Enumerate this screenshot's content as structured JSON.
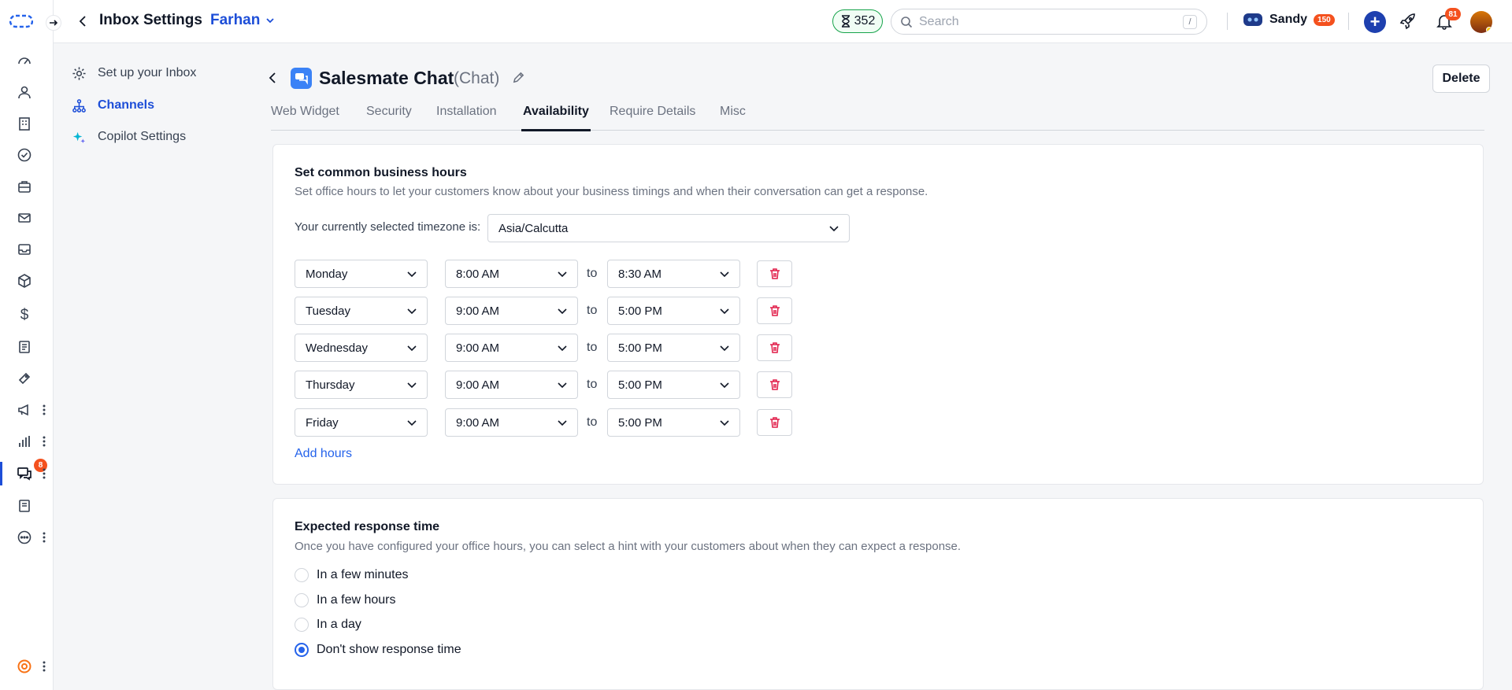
{
  "header": {
    "title": "Inbox Settings",
    "workspace": "Farhan",
    "timer_count": "352",
    "search_placeholder": "Search",
    "search_shortcut": "/",
    "user_name": "Sandy",
    "user_badge": "150",
    "notifications_count": "81"
  },
  "rail": {
    "chat_badge": "8"
  },
  "settings_nav": {
    "items": [
      {
        "label": "Set up your Inbox"
      },
      {
        "label": "Channels"
      },
      {
        "label": "Copilot Settings"
      }
    ]
  },
  "channel": {
    "name": "Salesmate Chat",
    "type": "(Chat)",
    "delete_label": "Delete"
  },
  "tabs": [
    {
      "label": "Web Widget"
    },
    {
      "label": "Security"
    },
    {
      "label": "Installation"
    },
    {
      "label": "Availability"
    },
    {
      "label": "Require Details"
    },
    {
      "label": "Misc"
    }
  ],
  "business_hours": {
    "title": "Set common business hours",
    "description": "Set office hours to let your customers know about your business timings and when their conversation can get a response.",
    "timezone_label": "Your currently selected timezone is:",
    "timezone": "Asia/Calcutta",
    "to_label": "to",
    "rows": [
      {
        "day": "Monday",
        "from": "8:00 AM",
        "to": "8:30 AM"
      },
      {
        "day": "Tuesday",
        "from": "9:00 AM",
        "to": "5:00 PM"
      },
      {
        "day": "Wednesday",
        "from": "9:00 AM",
        "to": "5:00 PM"
      },
      {
        "day": "Thursday",
        "from": "9:00 AM",
        "to": "5:00 PM"
      },
      {
        "day": "Friday",
        "from": "9:00 AM",
        "to": "5:00 PM"
      }
    ],
    "add_hours_label": "Add hours"
  },
  "response_time": {
    "title": "Expected response time",
    "description": "Once you have configured your office hours, you can select a hint with your customers about when they can expect a response.",
    "options": [
      {
        "label": "In a few minutes",
        "selected": false
      },
      {
        "label": "In a few hours",
        "selected": false
      },
      {
        "label": "In a day",
        "selected": false
      },
      {
        "label": "Don't show response time",
        "selected": true
      }
    ]
  },
  "colors": {
    "accent": "#1d4ed8",
    "danger": "#e11d48",
    "badge": "#f4511e"
  },
  "icons": {
    "rail": [
      "logo-icon",
      "dashboard-icon",
      "contacts-icon",
      "companies-icon",
      "tasks-icon",
      "deals-icon",
      "email-icon",
      "inbox-icon",
      "products-icon",
      "dollar-icon",
      "forms-icon",
      "tickets-icon",
      "campaigns-icon",
      "reports-icon",
      "chat-icon",
      "knowledge-icon",
      "more-icon",
      "help-icon"
    ]
  }
}
